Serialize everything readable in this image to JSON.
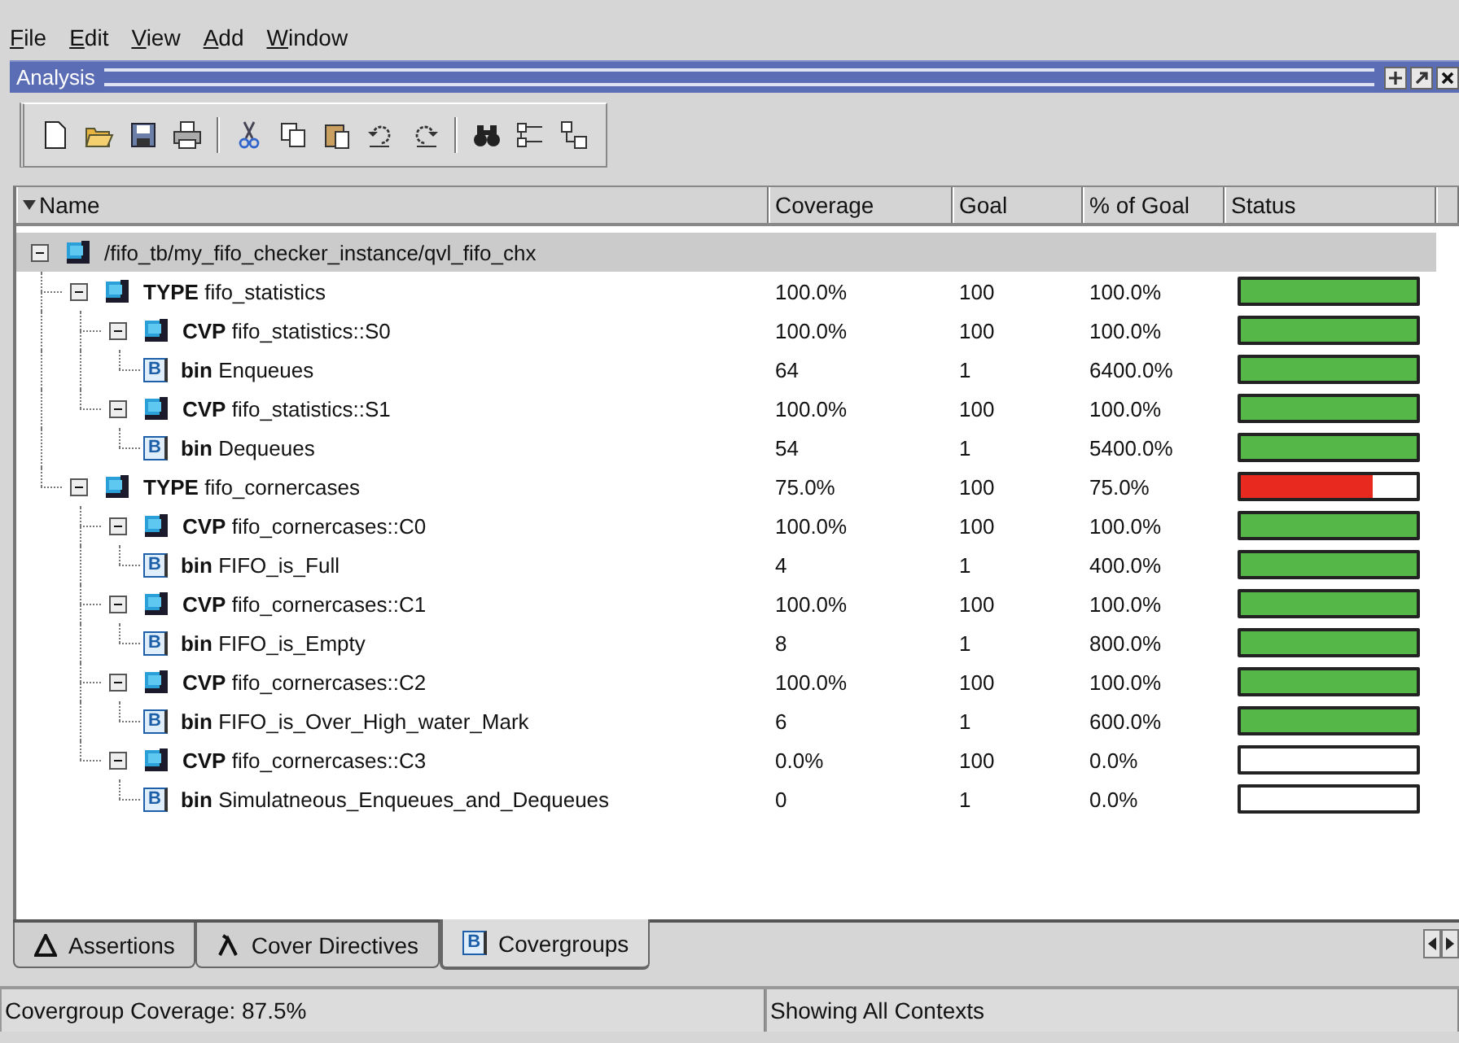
{
  "menu": [
    "File",
    "Edit",
    "View",
    "Add",
    "Window"
  ],
  "panel": {
    "title": "Analysis"
  },
  "columns": [
    "Name",
    "Coverage",
    "Goal",
    "% of Goal",
    "Status"
  ],
  "tree": [
    {
      "kind": "root",
      "name": "/fifo_tb/my_fifo_checker_instance/qvl_fifo_chx",
      "selected": true,
      "expanded": true,
      "children": [
        {
          "kind": "type",
          "name": "**TYPE** fifo_statistics",
          "coverage": "100.0%",
          "goal": "100",
          "percent": "100.0%",
          "status": {
            "level": 1,
            "color": "#55b748"
          },
          "selected": false,
          "expanded": true,
          "children": [
            {
              "kind": "cvp",
              "name": "**CVP** fifo_statistics::S0",
              "coverage": "100.0%",
              "goal": "100",
              "percent": "100.0%",
              "status": {
                "level": 1,
                "color": "#55b748"
              },
              "selected": false,
              "expanded": true,
              "children": [
                {
                  "kind": "bin",
                  "badge": "B",
                  "name": "**bin** Enqueues",
                  "coverage": "64",
                  "goal": "1",
                  "percent": "6400.0%",
                  "status": {
                    "level": 1,
                    "color": "#55b748"
                  },
                  "selected": false
                }
              ]
            },
            {
              "kind": "cvp",
              "name": "**CVP** fifo_statistics::S1",
              "coverage": "100.0%",
              "goal": "100",
              "percent": "100.0%",
              "status": {
                "level": 1,
                "color": "#55b748"
              },
              "selected": false,
              "expanded": true,
              "children": [
                {
                  "kind": "bin",
                  "badge": "B",
                  "name": "**bin** Dequeues",
                  "coverage": "54",
                  "goal": "1",
                  "percent": "5400.0%",
                  "status": {
                    "level": 1,
                    "color": "#55b748"
                  },
                  "selected": false
                }
              ]
            }
          ]
        },
        {
          "kind": "type",
          "name": "**TYPE** fifo_cornercases",
          "coverage": "75.0%",
          "goal": "100",
          "percent": "75.0%",
          "status": {
            "level": 0.75,
            "color": "#e8291f"
          },
          "selected": false,
          "expanded": true,
          "children": [
            {
              "kind": "cvp",
              "name": "**CVP** fifo_cornercases::C0",
              "coverage": "100.0%",
              "goal": "100",
              "percent": "100.0%",
              "status": {
                "level": 1,
                "color": "#55b748"
              },
              "selected": false,
              "expanded": true,
              "children": [
                {
                  "kind": "bin",
                  "badge": "B",
                  "name": "**bin** FIFO_is_Full",
                  "coverage": "4",
                  "goal": "1",
                  "percent": "400.0%",
                  "status": {
                    "level": 1,
                    "color": "#55b748"
                  },
                  "selected": false
                }
              ]
            },
            {
              "kind": "cvp",
              "name": "**CVP** fifo_cornercases::C1",
              "coverage": "100.0%",
              "goal": "100",
              "percent": "100.0%",
              "status": {
                "level": 1,
                "color": "#55b748"
              },
              "selected": false,
              "expanded": true,
              "children": [
                {
                  "kind": "bin",
                  "badge": "B",
                  "name": "**bin** FIFO_is_Empty",
                  "coverage": "8",
                  "goal": "1",
                  "percent": "800.0%",
                  "status": {
                    "level": 1,
                    "color": "#55b748"
                  },
                  "selected": false
                }
              ]
            },
            {
              "kind": "cvp",
              "name": "**CVP** fifo_cornercases::C2",
              "coverage": "100.0%",
              "goal": "100",
              "percent": "100.0%",
              "status": {
                "level": 1,
                "color": "#55b748"
              },
              "selected": false,
              "expanded": true,
              "children": [
                {
                  "kind": "bin",
                  "badge": "B",
                  "name": "**bin** FIFO_is_Over_High_water_Mark",
                  "coverage": "6",
                  "goal": "1",
                  "percent": "600.0%",
                  "status": {
                    "level": 1,
                    "color": "#55b748"
                  },
                  "selected": false
                }
              ]
            },
            {
              "kind": "cvp",
              "name": "**CVP** fifo_cornercases::C3",
              "coverage": "0.0%",
              "goal": "100",
              "percent": "0.0%",
              "selected": false,
              "expanded": true,
              "children": [
                {
                  "kind": "bin",
                  "badge": "B",
                  "name": "**bin** Simulatneous_Enqueues_and_Dequeues",
                  "coverage": "0",
                  "goal": "1",
                  "percent": "0.0%",
                  "selected": false
                }
              ]
            }
          ]
        }
      ]
    }
  ],
  "tabs": [
    {
      "kind": "assertion",
      "label": "Assertions",
      "selected": false
    },
    {
      "kind": "directive",
      "label": "Cover Directives",
      "selected": false
    },
    {
      "kind": "covergroup",
      "badge": "B",
      "label": "Covergroups",
      "selected": true
    }
  ],
  "status_bar": [
    "Covergroup Coverage: 87.5%",
    "Showing All Contexts"
  ]
}
